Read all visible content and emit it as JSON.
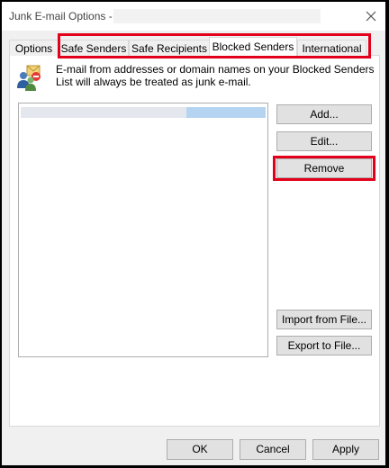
{
  "window": {
    "title": "Junk E-mail Options -",
    "close_icon": "close-icon"
  },
  "tabs": [
    {
      "label": "Options",
      "active": false
    },
    {
      "label": "Safe Senders",
      "active": false
    },
    {
      "label": "Safe Recipients",
      "active": false
    },
    {
      "label": "Blocked Senders",
      "active": true
    },
    {
      "label": "International",
      "active": false
    }
  ],
  "blocked_senders": {
    "icon": "blocked-senders-icon",
    "description": "E-mail from addresses or domain names on your Blocked Senders List will always be treated as junk e-mail.",
    "buttons": {
      "add": "Add...",
      "edit": "Edit...",
      "remove": "Remove",
      "import": "Import from File...",
      "export": "Export to File..."
    }
  },
  "footer": {
    "ok": "OK",
    "cancel": "Cancel",
    "apply": "Apply"
  },
  "colors": {
    "highlight": "#e2001a",
    "selection": "#b5d4f2"
  }
}
